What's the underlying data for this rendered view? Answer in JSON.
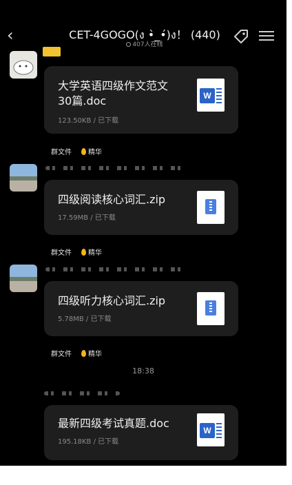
{
  "header": {
    "back_icon": "chevron-left-icon",
    "title": "CET-4GOGO(ง •̀_•́)ง！ (440)",
    "online": "407人在线",
    "tag_icon": "tag-icon",
    "menu_icon": "menu-icon"
  },
  "messages": [
    {
      "file_name_line1": "大学英语四级作文范文",
      "file_name_line2": "30篇.doc",
      "meta": "123.50KB / 已下载",
      "type": "word"
    },
    {
      "file_name": "四级阅读核心词汇.zip",
      "meta": "17.59MB / 已下载",
      "type": "zip"
    },
    {
      "file_name": "四级听力核心词汇.zip",
      "meta": "5.78MB / 已下载",
      "type": "zip"
    },
    {
      "file_name": "最新四级考试真题.doc",
      "meta": "195.18KB / 已下载",
      "type": "word"
    }
  ],
  "tags": {
    "group_file": "群文件",
    "essence": "精华"
  },
  "timestamp": "18:38",
  "colors": {
    "background": "#000000",
    "bubble": "#1e1e1e",
    "word_blue": "#2b63c7",
    "essence_flame": "#f2b51a"
  }
}
